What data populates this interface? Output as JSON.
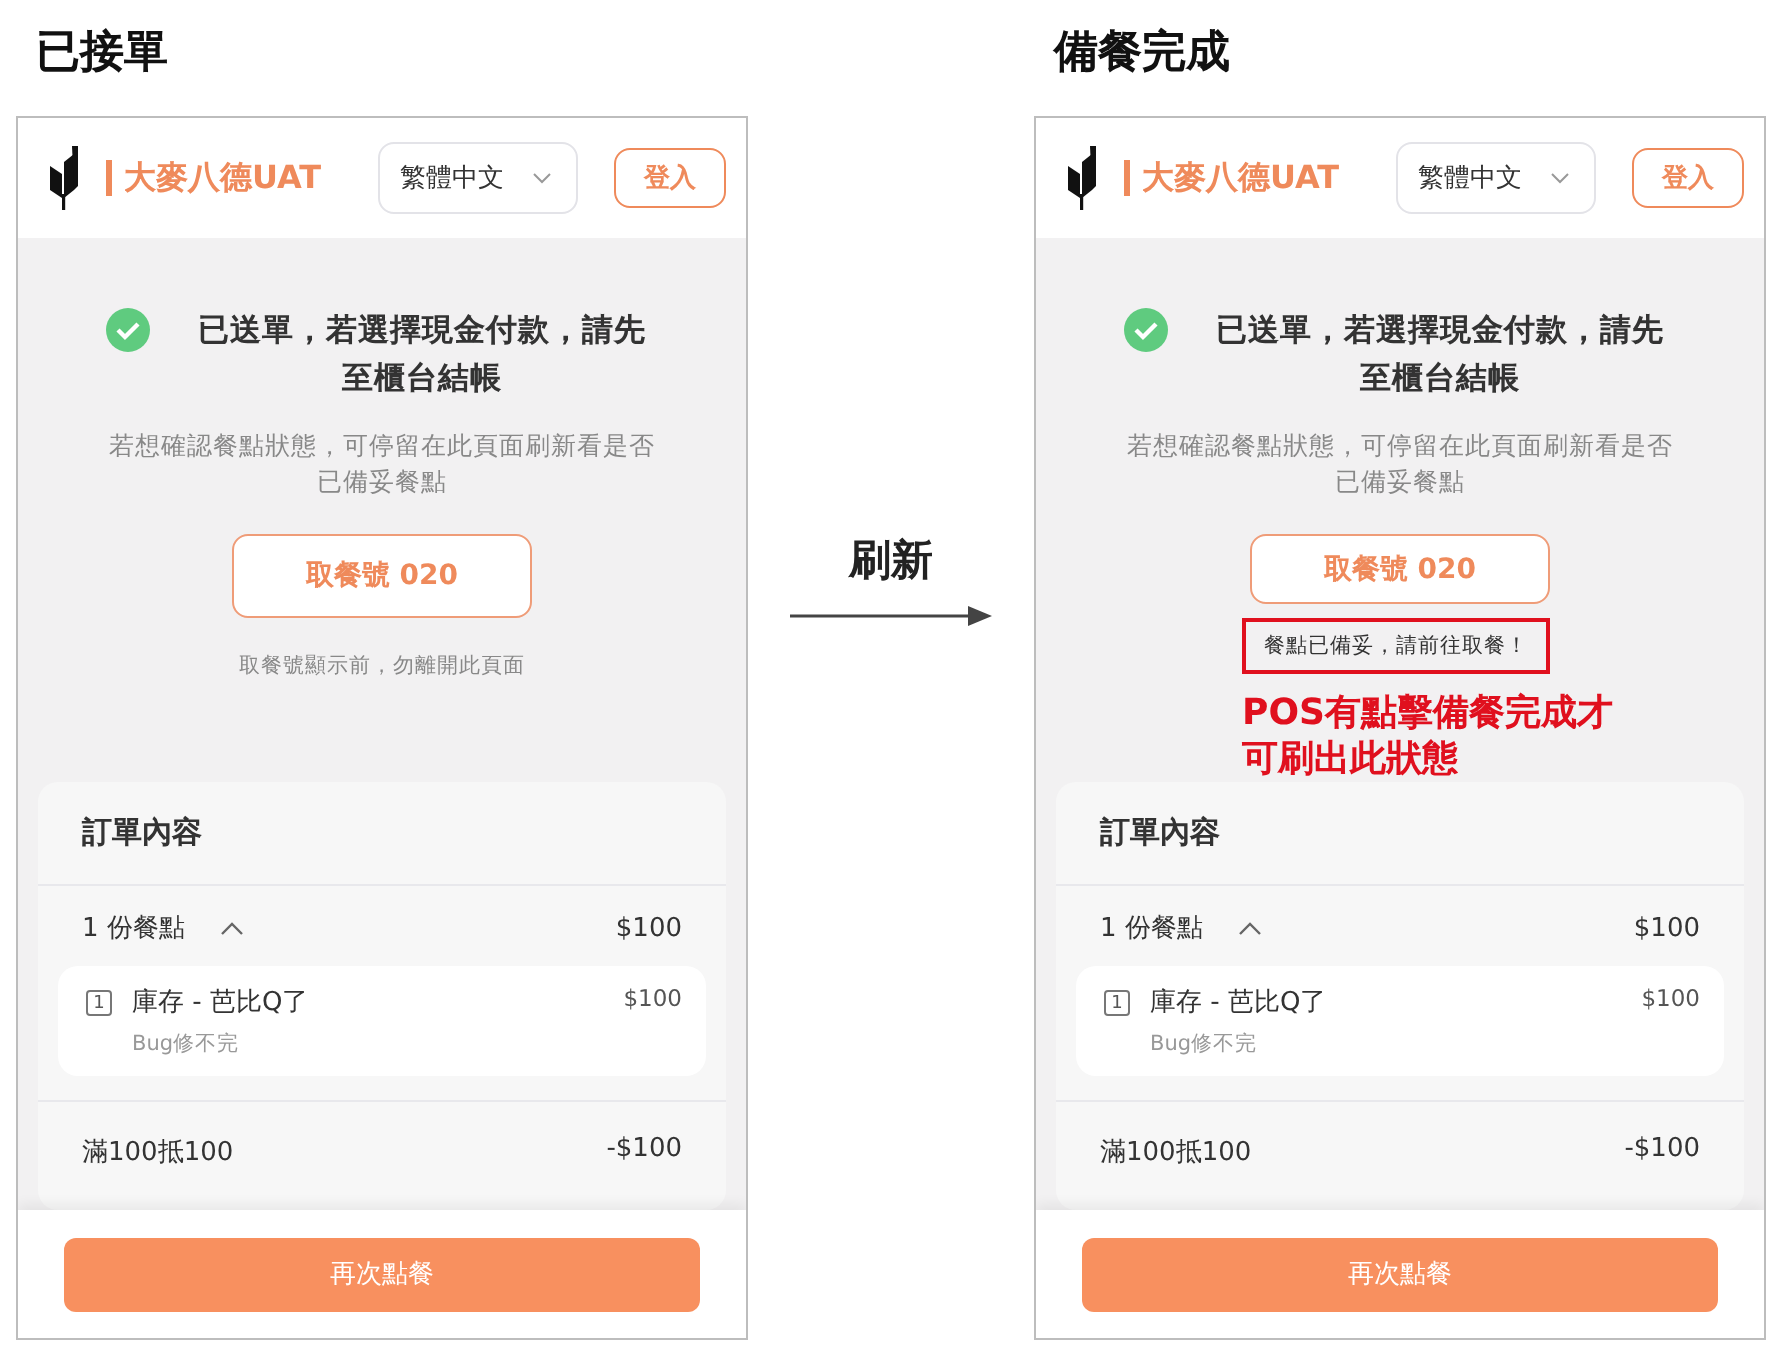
{
  "panels": [
    {
      "heading": "已接單",
      "header": {
        "brand": "大麥八德UAT",
        "language": "繁體中文",
        "login": "登入"
      },
      "status": {
        "title": "已送單，若選擇現金付款，請先至櫃台結帳",
        "description": "若想確認餐點狀態，可停留在此頁面刷新看是否已備妥餐點",
        "pickup_button": "取餐號 020",
        "hint": "取餐號顯示前，勿離開此頁面"
      },
      "order": {
        "title": "訂單內容",
        "summary": {
          "label": "1 份餐點",
          "expanded": true,
          "amount": "$100"
        },
        "items": [
          {
            "qty": "1",
            "name": "庫存 - 芭比Q了",
            "note": "Bug修不完",
            "price": "$100"
          }
        ],
        "discounts": [
          {
            "label": "滿100抵100",
            "amount": "-$100"
          }
        ]
      },
      "footer_button": "再次點餐"
    },
    {
      "heading": "備餐完成",
      "header": {
        "brand": "大麥八德UAT",
        "language": "繁體中文",
        "login": "登入"
      },
      "status": {
        "title": "已送單，若選擇現金付款，請先至櫃台結帳",
        "description": "若想確認餐點狀態，可停留在此頁面刷新看是否已備妥餐點",
        "pickup_button": "取餐號 020",
        "notice": "餐點已備妥，請前往取餐！",
        "annotation": "POS有點擊備餐完成才可刷出此狀態"
      },
      "order": {
        "title": "訂單內容",
        "summary": {
          "label": "1 份餐點",
          "expanded": true,
          "amount": "$100"
        },
        "items": [
          {
            "qty": "1",
            "name": "庫存 - 芭比Q了",
            "note": "Bug修不完",
            "price": "$100"
          }
        ],
        "discounts": [
          {
            "label": "滿100抵100",
            "amount": "-$100"
          }
        ]
      },
      "footer_button": "再次點餐"
    }
  ],
  "transition": {
    "label": "刷新"
  }
}
